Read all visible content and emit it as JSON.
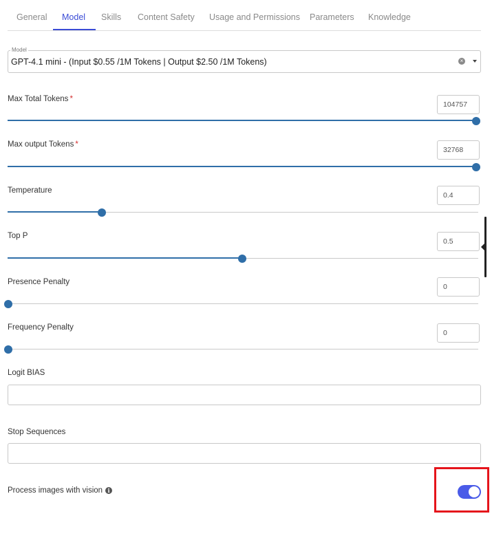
{
  "tabs": [
    {
      "label": "General",
      "active": false
    },
    {
      "label": "Model",
      "active": true
    },
    {
      "label": "Skills",
      "active": false
    },
    {
      "label": "Content Safety",
      "active": false
    },
    {
      "label": "Usage and Permissions",
      "active": false
    },
    {
      "label": "Parameters",
      "active": false
    },
    {
      "label": "Knowledge",
      "active": false
    }
  ],
  "model": {
    "legend": "Model",
    "value": "GPT-4.1 mini - (Input $0.55 /1M Tokens | Output $2.50 /1M Tokens)"
  },
  "params": {
    "max_total_tokens": {
      "label": "Max Total Tokens",
      "required": "*",
      "value": "104757",
      "slider_fraction": 1.0
    },
    "max_output_tokens": {
      "label": "Max output Tokens",
      "required": "*",
      "value": "32768",
      "slider_fraction": 1.0
    },
    "temperature": {
      "label": "Temperature",
      "value": "0.4",
      "slider_fraction": 0.2
    },
    "top_p": {
      "label": "Top P",
      "value": "0.5",
      "slider_fraction": 0.5
    },
    "presence_penalty": {
      "label": "Presence Penalty",
      "value": "0",
      "slider_fraction": 0.0
    },
    "frequency_penalty": {
      "label": "Frequency Penalty",
      "value": "0",
      "slider_fraction": 0.0
    }
  },
  "logit_bias": {
    "label": "Logit BIAS",
    "value": ""
  },
  "stop_sequences": {
    "label": "Stop Sequences",
    "value": ""
  },
  "vision": {
    "label": "Process images with vision",
    "enabled": true
  },
  "colors": {
    "accent": "#3a4bd6",
    "slider": "#2f6ea8",
    "toggle": "#4a5be8",
    "highlight": "#e5141b",
    "required": "#d32f2f"
  }
}
